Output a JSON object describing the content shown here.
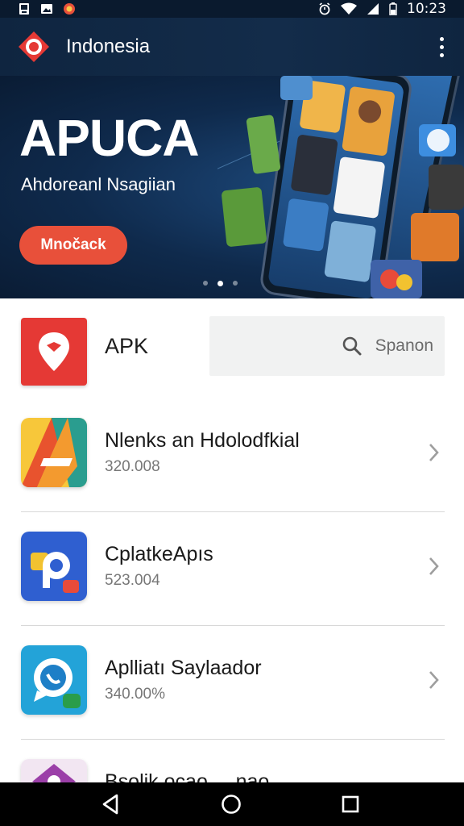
{
  "status_bar": {
    "time": "10:23",
    "icons": [
      "gallery-notification-icon",
      "image-notification-icon",
      "app-notification-icon",
      "alarm-icon",
      "wifi-icon",
      "signal-icon",
      "battery-icon"
    ]
  },
  "app_bar": {
    "title": "Indonesia",
    "logo_icon": "app-logo-icon",
    "menu_icon": "more-vert-icon"
  },
  "hero": {
    "title": "APUCA",
    "subtitle": "Ahdoreanl Nsagiian",
    "button_label": "Mnočack",
    "accent": "#e8503a",
    "carousel": {
      "pages": 3,
      "active": 2
    }
  },
  "header_row": {
    "brand_label": "APK",
    "brand_color": "#e53935",
    "search_placeholder": "Spanon"
  },
  "apps": [
    {
      "name": "Nlenks an Hdolodfkial",
      "meta": "320.008",
      "icon": "triangle-a-icon"
    },
    {
      "name": "CplatkeApıs",
      "meta": "523.004",
      "icon": "blue-p-icon"
    },
    {
      "name": "Aplliatı Saylaador",
      "meta": "340.00%",
      "icon": "chat-bubble-icon"
    },
    {
      "name": "Bsolik ocao ... nao",
      "meta": "",
      "icon": "purple-app-icon"
    }
  ],
  "nav_bar": {
    "buttons": [
      "back-icon",
      "home-icon",
      "recents-icon"
    ]
  }
}
